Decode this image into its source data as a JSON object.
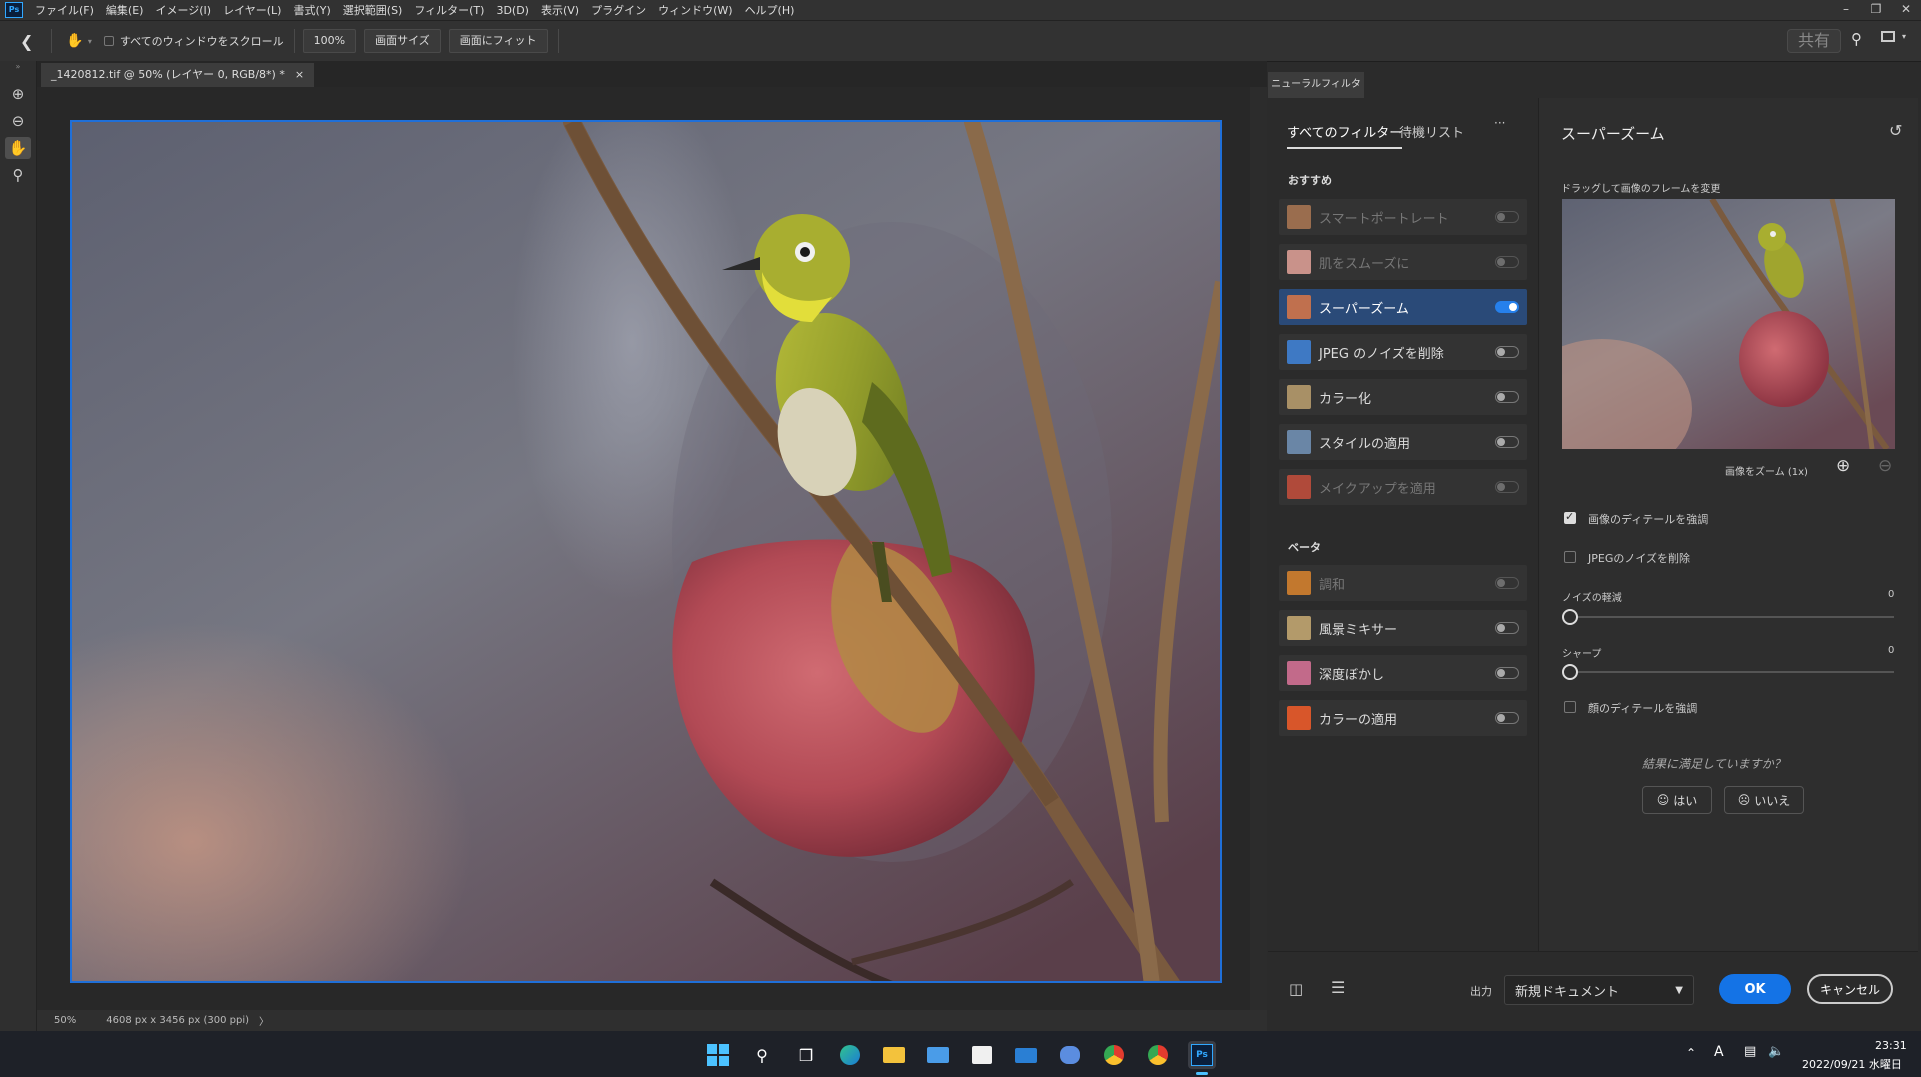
{
  "app": {
    "badge": "Ps"
  },
  "menu": [
    "ファイル(F)",
    "編集(E)",
    "イメージ(I)",
    "レイヤー(L)",
    "書式(Y)",
    "選択範囲(S)",
    "フィルター(T)",
    "3D(D)",
    "表示(V)",
    "プラグイン",
    "ウィンドウ(W)",
    "ヘルプ(H)"
  ],
  "window_controls": [
    "–",
    "❐",
    "✕"
  ],
  "options": {
    "scroll_all_label": "すべてのウィンドウをスクロール",
    "zoom_btn": "100%",
    "screen_size_btn": "画面サイズ",
    "fit_btn": "画面にフィット",
    "share_btn": "共有"
  },
  "document": {
    "tab_title": "_1420812.tif @ 50% (レイヤー 0, RGB/8*) *",
    "close": "×",
    "zoom": "50%",
    "info": "4608 px x 3456 px (300 ppi)",
    "info_arrow": "〉"
  },
  "neural": {
    "panel_tab": "ニューラルフィルター",
    "tabs": [
      "すべてのフィルター",
      "待機リスト"
    ],
    "more": "···",
    "featured_label": "おすすめ",
    "featured": [
      {
        "label": "スマートポートレート",
        "on": false,
        "enabled": false,
        "color": "#9a6d4e"
      },
      {
        "label": "肌をスムーズに",
        "on": false,
        "enabled": false,
        "color": "#c9928a"
      },
      {
        "label": "スーパーズーム",
        "on": true,
        "enabled": true,
        "color": "#c0704e"
      },
      {
        "label": "JPEG のノイズを削除",
        "on": false,
        "enabled": true,
        "color": "#3e79c4"
      },
      {
        "label": "カラー化",
        "on": false,
        "enabled": true,
        "color": "#a89066"
      },
      {
        "label": "スタイルの適用",
        "on": false,
        "enabled": true,
        "color": "#6a86a6"
      },
      {
        "label": "メイクアップを適用",
        "on": false,
        "enabled": false,
        "color": "#b04a3a"
      }
    ],
    "beta_label": "ベータ",
    "beta": [
      {
        "label": "調和",
        "on": false,
        "enabled": false,
        "color": "#c2782e"
      },
      {
        "label": "風景ミキサー",
        "on": false,
        "enabled": true,
        "color": "#b39a6a"
      },
      {
        "label": "深度ぼかし",
        "on": false,
        "enabled": true,
        "color": "#c26a8a"
      },
      {
        "label": "カラーの適用",
        "on": false,
        "enabled": true,
        "color": "#d8562a"
      }
    ]
  },
  "settings": {
    "title": "スーパーズーム",
    "drag_hint": "ドラッグして画像のフレームを変更",
    "zoom_label": "画像をズーム (1x)",
    "enhance_detail": {
      "label": "画像のディテールを強調",
      "checked": true
    },
    "remove_jpeg": {
      "label": "JPEGのノイズを削除",
      "checked": false
    },
    "noise": {
      "label": "ノイズの軽減",
      "value": "0"
    },
    "sharpen": {
      "label": "シャープ",
      "value": "0"
    },
    "face_detail": {
      "label": "顔のディテールを強調",
      "checked": false
    },
    "feedback_q": "結果に満足していますか？",
    "yes": "はい",
    "no": "いいえ"
  },
  "footer": {
    "output_label": "出力",
    "output_value": "新規ドキュメント",
    "ok": "OK",
    "cancel": "キャンセル"
  },
  "taskbar": {
    "time": "23:31",
    "date": "2022/09/21 水曜日",
    "ime": "A"
  },
  "colors": {
    "accent": "#1473e6",
    "selection": "#2a4a78",
    "canvas_border": "#1f6fd8"
  }
}
